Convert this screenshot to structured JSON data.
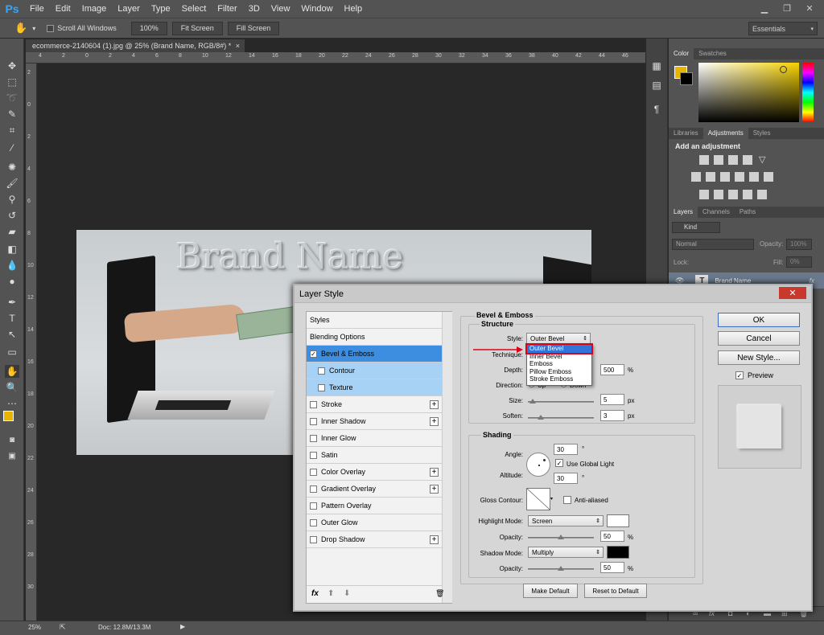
{
  "app": {
    "logo": "Ps"
  },
  "menu": [
    "File",
    "Edit",
    "Image",
    "Layer",
    "Type",
    "Select",
    "Filter",
    "3D",
    "View",
    "Window",
    "Help"
  ],
  "window_controls": {
    "minimize": "▁",
    "restore": "❐",
    "close": "✕"
  },
  "options_bar": {
    "scroll_all": "Scroll All Windows",
    "zoom100": "100%",
    "fit_screen": "Fit Screen",
    "fill_screen": "Fill Screen",
    "workspace": "Essentials"
  },
  "document": {
    "tab_title": "ecommerce-2140604 (1).jpg @ 25% (Brand Name, RGB/8#) *",
    "close": "×",
    "brand_text": "Brand Name"
  },
  "ruler_top": [
    "4",
    "2",
    "0",
    "2",
    "4",
    "6",
    "8",
    "10",
    "12",
    "14",
    "16",
    "18",
    "20",
    "22",
    "24",
    "26",
    "28",
    "30",
    "32",
    "34",
    "36",
    "38",
    "40",
    "42",
    "44",
    "46"
  ],
  "ruler_left": [
    "2",
    "0",
    "2",
    "4",
    "6",
    "8",
    "10",
    "12",
    "14",
    "16",
    "18",
    "20",
    "22",
    "24",
    "26",
    "28",
    "30"
  ],
  "status": {
    "zoom": "25%",
    "doc": "Doc: 12.8M/13.3M"
  },
  "color_panel": {
    "tabs": [
      "Color",
      "Swatches"
    ],
    "fg_color": "#e8b400",
    "bg_color": "#000000"
  },
  "adjustments_panel": {
    "tabs": [
      "Libraries",
      "Adjustments",
      "Styles"
    ],
    "heading": "Add an adjustment"
  },
  "layers_panel": {
    "tabs": [
      "Layers",
      "Channels",
      "Paths"
    ],
    "kind": "Kind",
    "blend": "Normal",
    "opacity_label": "Opacity:",
    "opacity": "100%",
    "lock_label": "Lock:",
    "fill_label": "Fill:",
    "fill": "0%",
    "layer_name": "Brand Name",
    "fx": "fx"
  },
  "layer_style": {
    "title": "Layer Style",
    "close": "✕",
    "list": [
      {
        "label": "Styles",
        "checkbox": false,
        "plus": false
      },
      {
        "label": "Blending Options",
        "checkbox": false,
        "plus": false
      },
      {
        "label": "Bevel & Emboss",
        "checkbox": true,
        "checked": true,
        "plus": false
      },
      {
        "label": "Contour",
        "checkbox": true,
        "plus": false
      },
      {
        "label": "Texture",
        "checkbox": true,
        "plus": false
      },
      {
        "label": "Stroke",
        "checkbox": true,
        "plus": true
      },
      {
        "label": "Inner Shadow",
        "checkbox": true,
        "plus": true
      },
      {
        "label": "Inner Glow",
        "checkbox": true,
        "plus": false
      },
      {
        "label": "Satin",
        "checkbox": true,
        "plus": false
      },
      {
        "label": "Color Overlay",
        "checkbox": true,
        "plus": true
      },
      {
        "label": "Gradient Overlay",
        "checkbox": true,
        "plus": true
      },
      {
        "label": "Pattern Overlay",
        "checkbox": true,
        "plus": false
      },
      {
        "label": "Outer Glow",
        "checkbox": true,
        "plus": false
      },
      {
        "label": "Drop Shadow",
        "checkbox": true,
        "plus": true
      }
    ],
    "list_footer": {
      "fx": "fx",
      "up": "⬆",
      "down": "⬇",
      "trash": "🗑"
    },
    "section_title": "Bevel & Emboss",
    "structure": {
      "title": "Structure",
      "style_label": "Style:",
      "style_value": "Outer Bevel",
      "technique_label": "Technique:",
      "depth_label": "Depth:",
      "depth": "500",
      "depth_unit": "%",
      "direction_label": "Direction:",
      "direction_up": "Up",
      "direction_down": "Down",
      "size_label": "Size:",
      "size": "5",
      "size_unit": "px",
      "soften_label": "Soften:",
      "soften": "3",
      "soften_unit": "px"
    },
    "style_options": [
      "Outer Bevel",
      "Inner Bevel",
      "Emboss",
      "Pillow Emboss",
      "Stroke Emboss"
    ],
    "shading": {
      "title": "Shading",
      "angle_label": "Angle:",
      "angle": "30",
      "degree": "°",
      "global_light": "Use Global Light",
      "altitude_label": "Altitude:",
      "altitude": "30",
      "gloss_label": "Gloss Contour:",
      "anti_aliased": "Anti-aliased",
      "highlight_label": "Highlight Mode:",
      "highlight_mode": "Screen",
      "highlight_color": "#ffffff",
      "h_opacity_label": "Opacity:",
      "h_opacity": "50",
      "pct": "%",
      "shadow_label": "Shadow Mode:",
      "shadow_mode": "Multiply",
      "shadow_color": "#000000",
      "s_opacity_label": "Opacity:",
      "s_opacity": "50"
    },
    "make_default": "Make Default",
    "reset_default": "Reset to Default",
    "ok": "OK",
    "cancel": "Cancel",
    "new_style": "New Style...",
    "preview": "Preview"
  }
}
